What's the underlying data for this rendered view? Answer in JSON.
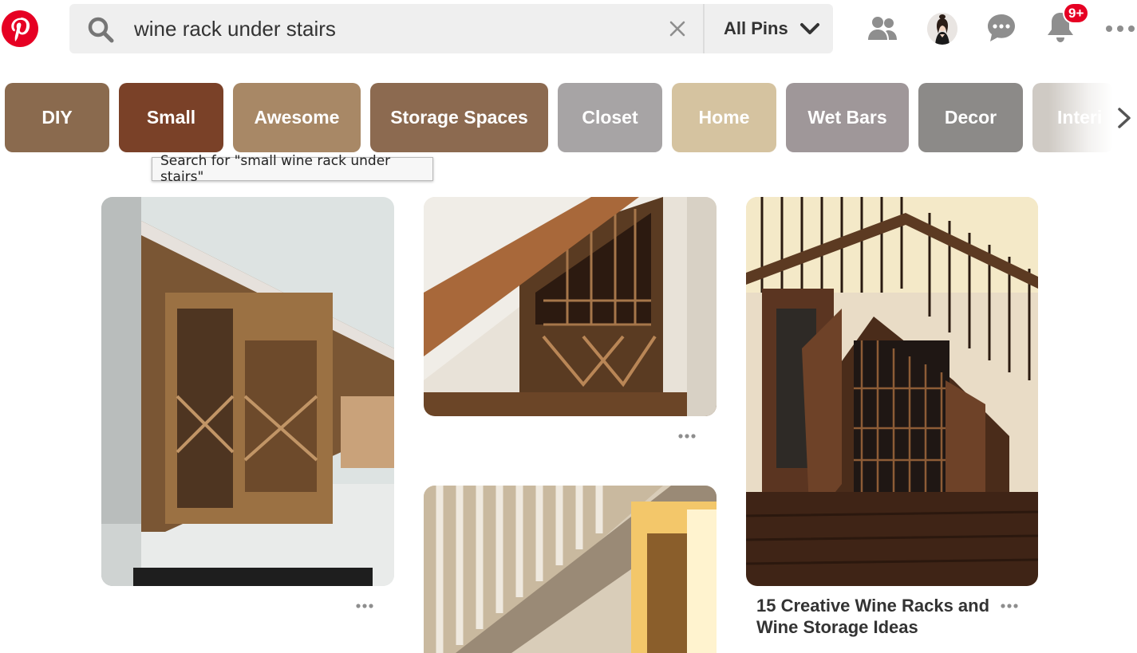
{
  "search": {
    "query": "wine rack under stairs",
    "scope_label": "All Pins"
  },
  "header": {
    "notification_badge": "9+",
    "icons": [
      "pinterest-logo",
      "search-icon",
      "clear-icon",
      "chevron-down-icon",
      "people-icon",
      "avatar",
      "messages-icon",
      "bell-icon",
      "more-icon"
    ]
  },
  "guides": [
    {
      "label": "DIY",
      "color": "#8a6a4e"
    },
    {
      "label": "Small",
      "color": "#7a4128"
    },
    {
      "label": "Awesome",
      "color": "#a88866"
    },
    {
      "label": "Storage Spaces",
      "color": "#8c6a50"
    },
    {
      "label": "Closet",
      "color": "#a7a4a5"
    },
    {
      "label": "Home",
      "color": "#d5c3a0"
    },
    {
      "label": "Wet Bars",
      "color": "#9f9799"
    },
    {
      "label": "Decor",
      "color": "#8c8a88"
    },
    {
      "label": "Interi",
      "color": "#cfcac4"
    }
  ],
  "tooltip": "Search for \"small wine rack under stairs\"",
  "pins": [
    {
      "title": ""
    },
    {
      "title": ""
    },
    {
      "title": ""
    },
    {
      "title": "15 Creative Wine Racks and Wine Storage Ideas"
    }
  ],
  "colors": {
    "brand": "#e60023"
  }
}
